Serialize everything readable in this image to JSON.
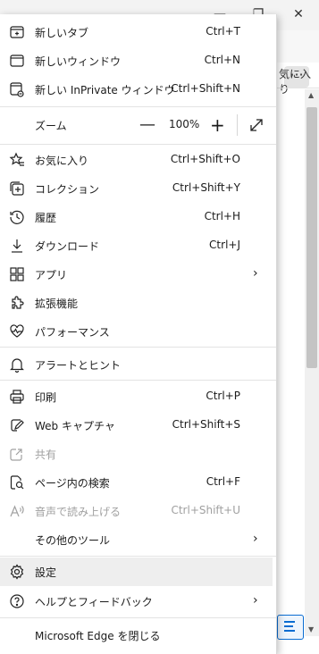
{
  "background": {
    "fav_fragment": "気に入り"
  },
  "menu": {
    "items": [
      {
        "id": "new-tab",
        "label": "新しいタブ",
        "shortcut": "Ctrl+T"
      },
      {
        "id": "new-window",
        "label": "新しいウィンドウ",
        "shortcut": "Ctrl+N"
      },
      {
        "id": "new-inprivate",
        "label": "新しい InPrivate ウィンドウ",
        "shortcut": "Ctrl+Shift+N"
      },
      {
        "id": "zoom",
        "label": "ズーム",
        "value": "100%"
      },
      {
        "id": "favorites",
        "label": "お気に入り",
        "shortcut": "Ctrl+Shift+O"
      },
      {
        "id": "collections",
        "label": "コレクション",
        "shortcut": "Ctrl+Shift+Y"
      },
      {
        "id": "history",
        "label": "履歴",
        "shortcut": "Ctrl+H"
      },
      {
        "id": "downloads",
        "label": "ダウンロード",
        "shortcut": "Ctrl+J"
      },
      {
        "id": "apps",
        "label": "アプリ",
        "shortcut": ""
      },
      {
        "id": "extensions",
        "label": "拡張機能",
        "shortcut": ""
      },
      {
        "id": "performance",
        "label": "パフォーマンス",
        "shortcut": ""
      },
      {
        "id": "alerts",
        "label": "アラートとヒント",
        "shortcut": ""
      },
      {
        "id": "print",
        "label": "印刷",
        "shortcut": "Ctrl+P"
      },
      {
        "id": "web-capture",
        "label": "Web キャプチャ",
        "shortcut": "Ctrl+Shift+S"
      },
      {
        "id": "share",
        "label": "共有",
        "shortcut": ""
      },
      {
        "id": "find",
        "label": "ページ内の検索",
        "shortcut": "Ctrl+F"
      },
      {
        "id": "read-aloud",
        "label": "音声で読み上げる",
        "shortcut": "Ctrl+Shift+U"
      },
      {
        "id": "more-tools",
        "label": "その他のツール",
        "shortcut": ""
      },
      {
        "id": "settings",
        "label": "設定",
        "shortcut": ""
      },
      {
        "id": "help",
        "label": "ヘルプとフィードバック",
        "shortcut": ""
      },
      {
        "id": "close-edge",
        "label": "Microsoft Edge を閉じる",
        "shortcut": ""
      }
    ]
  }
}
